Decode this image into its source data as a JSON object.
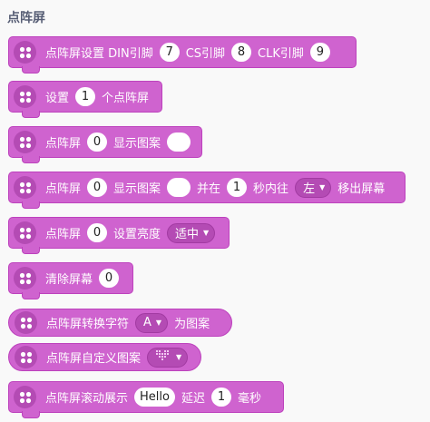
{
  "category_title": "点阵屏",
  "blocks": {
    "b1": {
      "t1": "点阵屏设置 DIN引脚",
      "v1": "7",
      "t2": "CS引脚",
      "v2": "8",
      "t3": "CLK引脚",
      "v3": "9"
    },
    "b2": {
      "t1": "设置",
      "v1": "1",
      "t2": "个点阵屏"
    },
    "b3": {
      "t1": "点阵屏",
      "v1": "0",
      "t2": "显示图案"
    },
    "b4": {
      "t1": "点阵屏",
      "v1": "0",
      "t2": "显示图案",
      "t3": "并在",
      "v2": "1",
      "t4": "秒内往",
      "d1": "左",
      "t5": "移出屏幕"
    },
    "b5": {
      "t1": "点阵屏",
      "v1": "0",
      "t2": "设置亮度",
      "d1": "适中"
    },
    "b6": {
      "t1": "清除屏幕",
      "v1": "0"
    },
    "b7": {
      "t1": "点阵屏转换字符",
      "d1": "A",
      "t2": "为图案"
    },
    "b8": {
      "t1": "点阵屏自定义图案"
    },
    "b9": {
      "t1": "点阵屏滚动展示",
      "v1": "Hello",
      "t2": "延迟",
      "v2": "1",
      "t3": "毫秒"
    }
  },
  "icons": {
    "block_icon": "four-dots-icon",
    "dropdown_caret": "caret-down-icon",
    "matrix_pattern": "heart-pattern-icon"
  },
  "colors": {
    "block": "#cf63cf",
    "block_border": "#bd42bd",
    "icon_bg": "#b44bb4",
    "field": "#ffffff",
    "background": "#f9f9f9"
  }
}
